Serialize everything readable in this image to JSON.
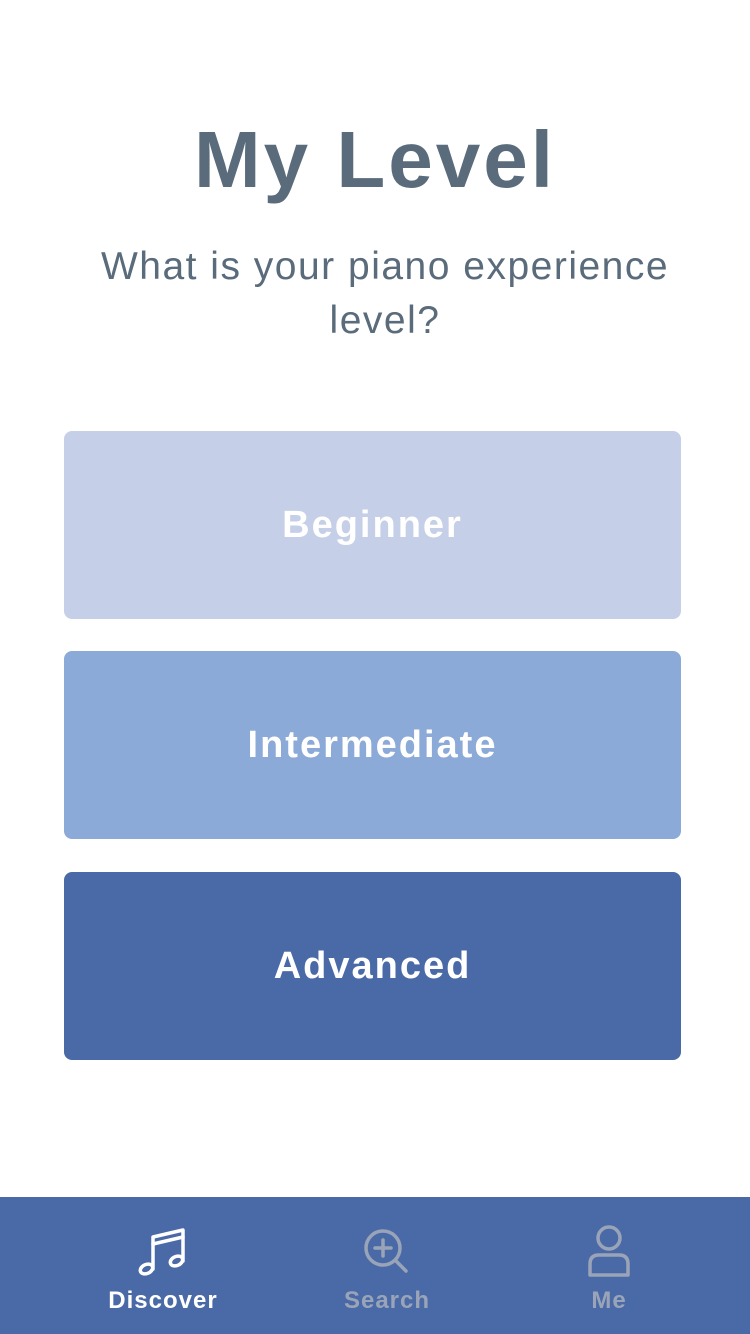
{
  "page": {
    "title": "My Level",
    "subtitle": "What is your piano experience level?"
  },
  "levels": [
    {
      "label": "Beginner",
      "color": "#c5cfe8"
    },
    {
      "label": "Intermediate",
      "color": "#8caad8"
    },
    {
      "label": "Advanced",
      "color": "#4a69a7"
    }
  ],
  "tabbar": {
    "background": "#4a69a7",
    "active_color": "#ffffff",
    "inactive_color": "#9aa4b8",
    "tabs": [
      {
        "label": "Discover",
        "icon": "music-note-icon",
        "active": true
      },
      {
        "label": "Search",
        "icon": "search-plus-icon",
        "active": false
      },
      {
        "label": "Me",
        "icon": "person-icon",
        "active": false
      }
    ]
  }
}
